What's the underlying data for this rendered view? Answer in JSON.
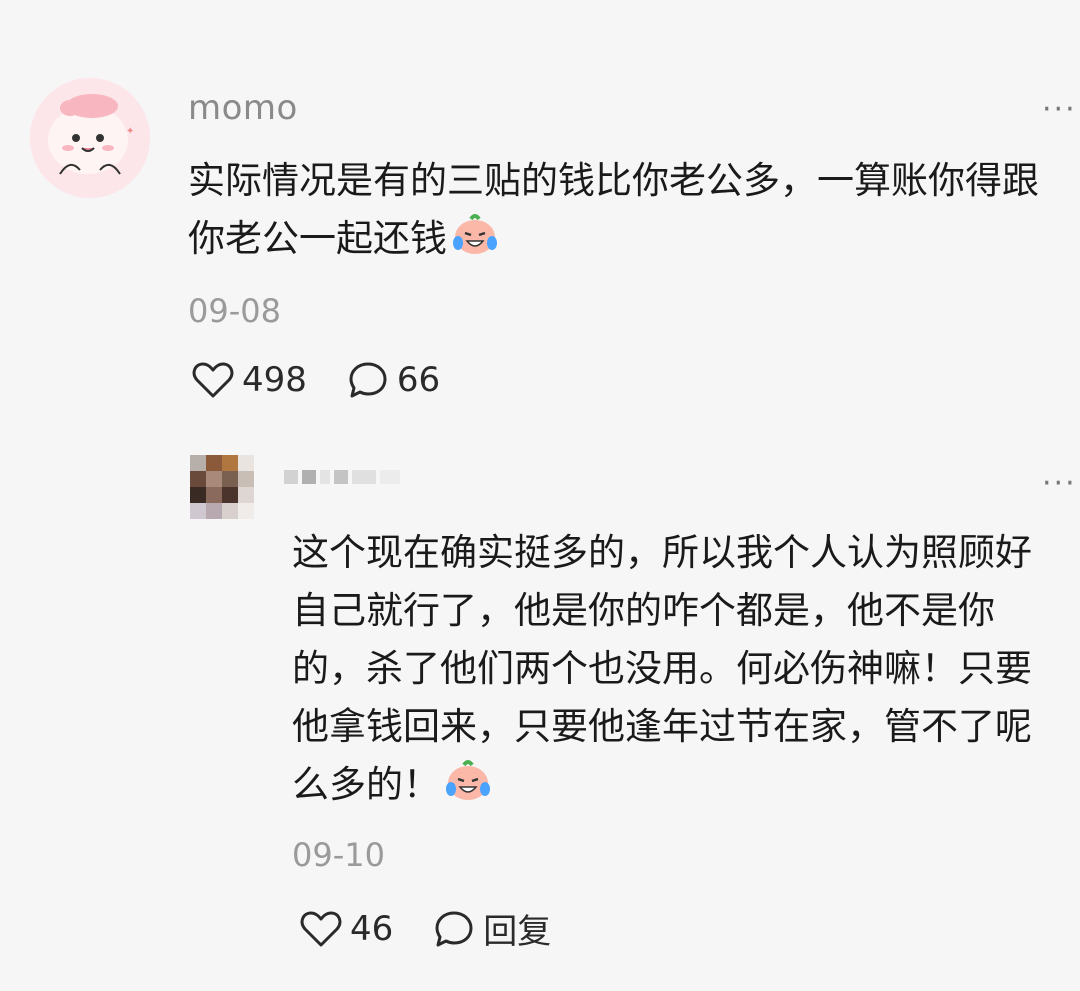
{
  "comment": {
    "username": "momo",
    "text": "实际情况是有的三贴的钱比你老公多，一算账你得跟你老公一起还钱",
    "date": "09-08",
    "likes": "498",
    "replies": "66"
  },
  "reply": {
    "text": "这个现在确实挺多的，所以我个人认为照顾好自己就行了，他是你的咋个都是，他不是你的，杀了他们两个也没用。何必伤神嘛！只要他拿钱回来，只要他逢年过节在家，管不了呢么多的！",
    "date": "09-10",
    "likes": "46",
    "reply_label": "回复"
  },
  "icons": {
    "more": "more-horizontal-icon",
    "like": "heart-icon",
    "comment": "speech-bubble-icon",
    "emoji": "crying-laughing-emoji"
  },
  "colors": {
    "background": "#f6f6f6",
    "meta_text": "#9a9a9a",
    "body_text": "#1a1a1a"
  }
}
